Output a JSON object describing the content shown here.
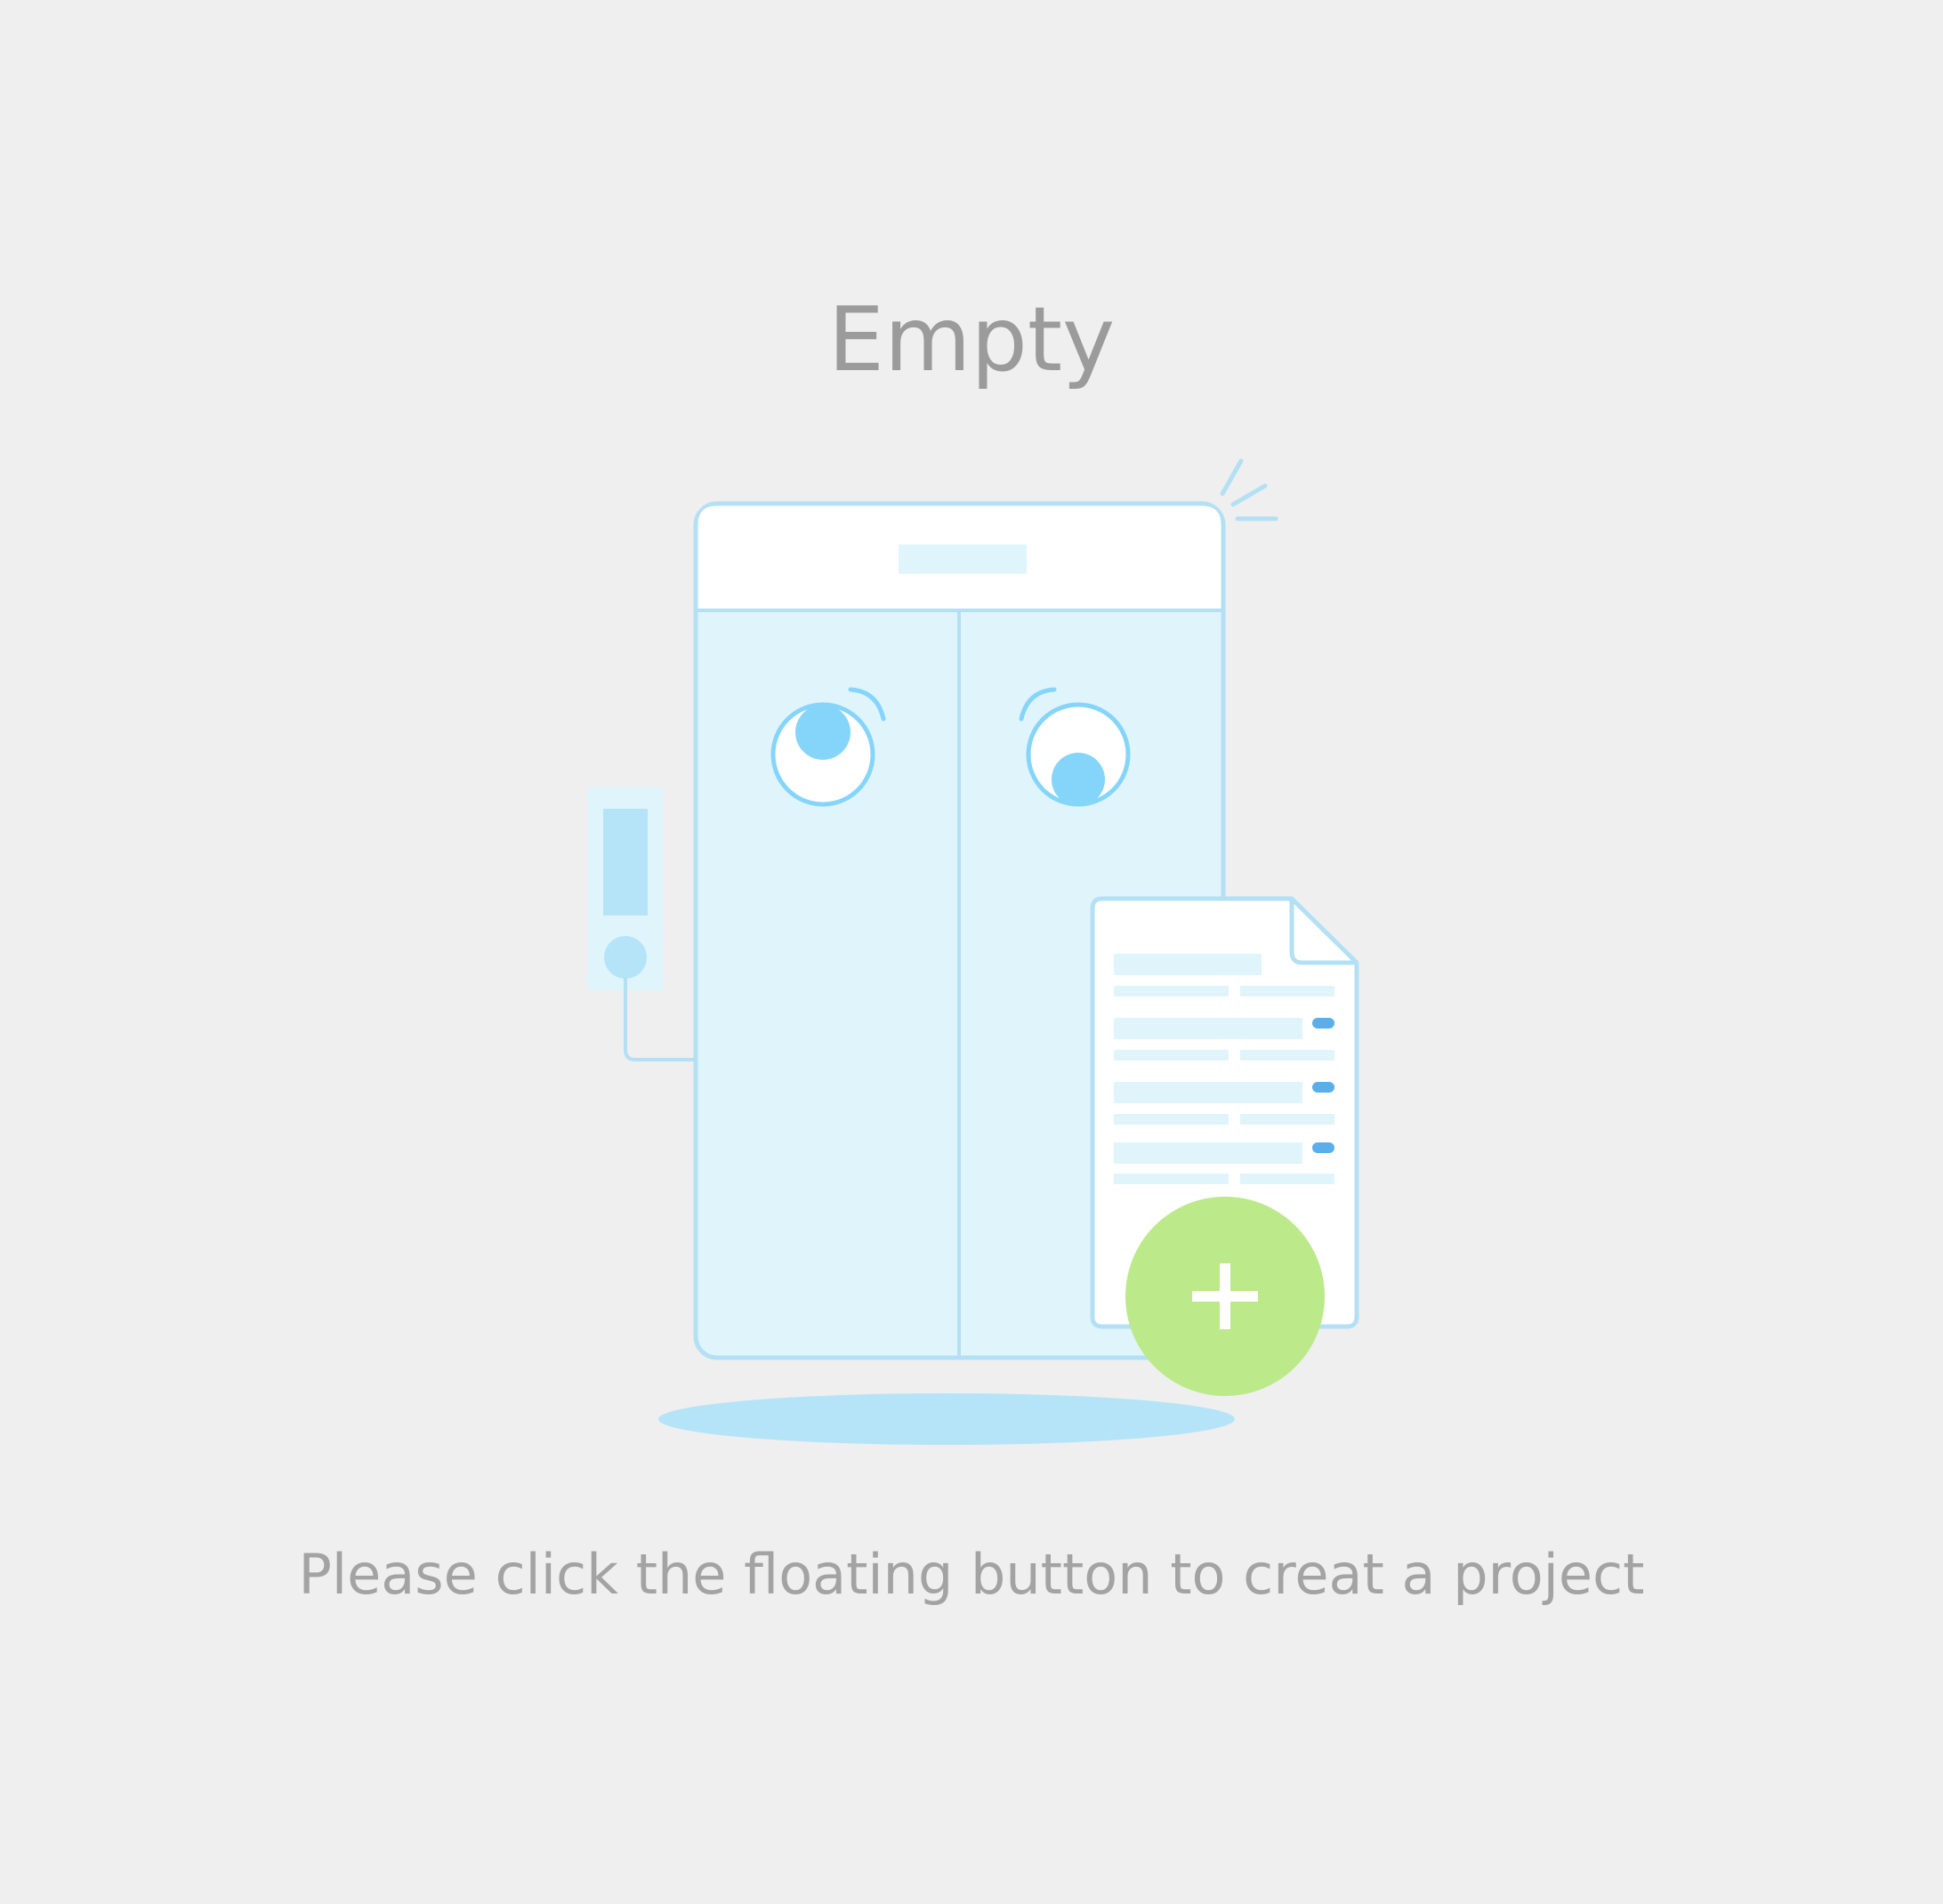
{
  "empty_state": {
    "title": "Empty",
    "message": "Please click the floating button to creat a project"
  },
  "illustration": {
    "subject": "elevator-with-document",
    "fab_icon": "plus-icon"
  },
  "colors": {
    "background": "#efefef",
    "text": "#9b9b9b",
    "line_blue": "#b3e0f5",
    "fill_light_blue": "#e0f4fc",
    "eye_blue": "#85d5fb",
    "accent_blue": "#5aaeea",
    "fab_green": "#bce98a"
  }
}
